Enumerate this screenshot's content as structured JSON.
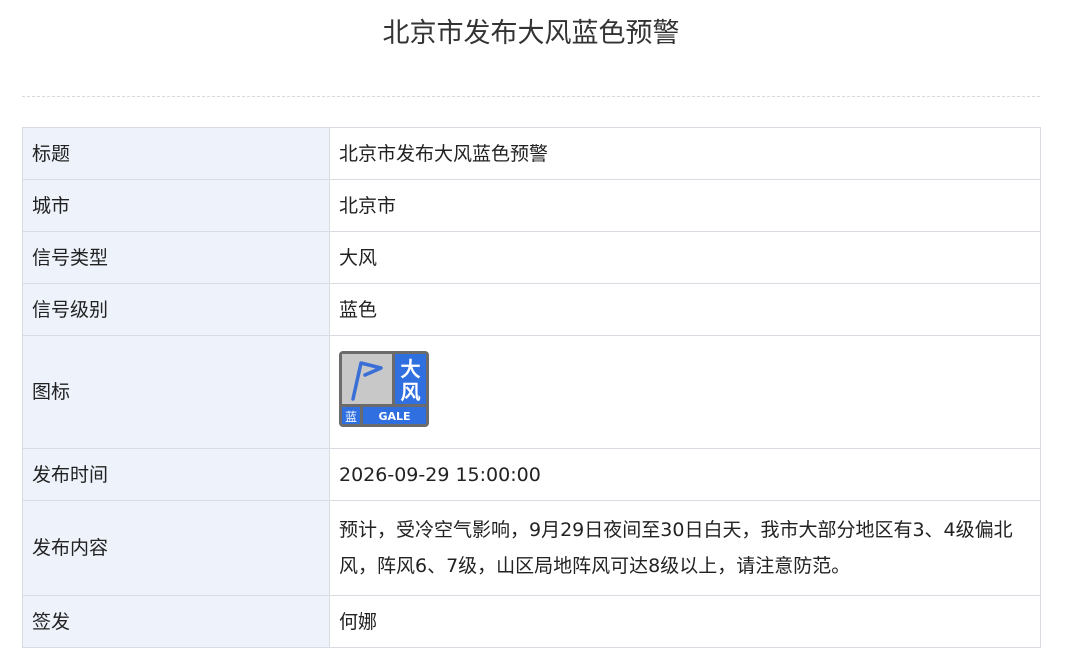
{
  "title": "北京市发布大风蓝色预警",
  "rows": [
    {
      "label": "标题",
      "value": "北京市发布大风蓝色预警"
    },
    {
      "label": "城市",
      "value": "北京市"
    },
    {
      "label": "信号类型",
      "value": "大风"
    },
    {
      "label": "信号级别",
      "value": "蓝色"
    },
    {
      "label": "图标",
      "value": ""
    },
    {
      "label": "发布时间",
      "value": "2026-09-29 15:00:00"
    },
    {
      "label": "发布内容",
      "value": "预计，受冷空气影响，9月29日夜间至30日白天，我市大部分地区有3、4级偏北风，阵风6、7级，山区局地阵风可达8级以上，请注意防范。"
    },
    {
      "label": "签发",
      "value": "何娜"
    }
  ],
  "icon": {
    "name": "gale-blue-warning-icon",
    "char_top": "大",
    "char_bottom": "风",
    "level_char": "蓝",
    "english": "GALE",
    "colors": {
      "frame": "#6b6b6b",
      "panel": "#c8c8c8",
      "blue": "#2f6fe0",
      "flag": "#3a6fd8",
      "text": "#ffffff"
    }
  }
}
